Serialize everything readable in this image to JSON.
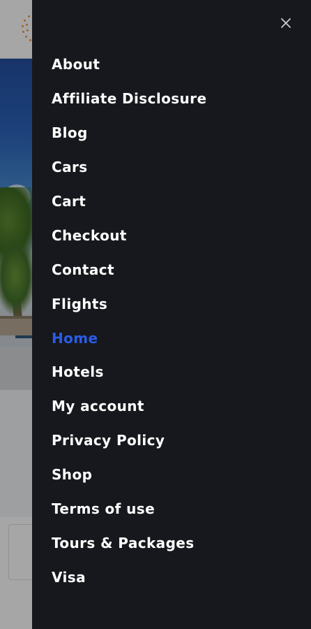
{
  "drawer": {
    "close_icon": "close-icon",
    "active_color": "#2a5ce6",
    "items": [
      {
        "label": "About"
      },
      {
        "label": "Affiliate Disclosure"
      },
      {
        "label": "Blog"
      },
      {
        "label": "Cars"
      },
      {
        "label": "Cart"
      },
      {
        "label": "Checkout"
      },
      {
        "label": "Contact"
      },
      {
        "label": "Flights"
      },
      {
        "label": "Home",
        "active": true
      },
      {
        "label": "Hotels"
      },
      {
        "label": "My account"
      },
      {
        "label": "Privacy Policy"
      },
      {
        "label": "Shop"
      },
      {
        "label": "Terms of use"
      },
      {
        "label": "Tours & Packages"
      },
      {
        "label": "Visa"
      }
    ]
  },
  "background_colors": {
    "header": "#ffffff",
    "drawer": "#16181d",
    "hero_sky": "#2c64bc"
  }
}
